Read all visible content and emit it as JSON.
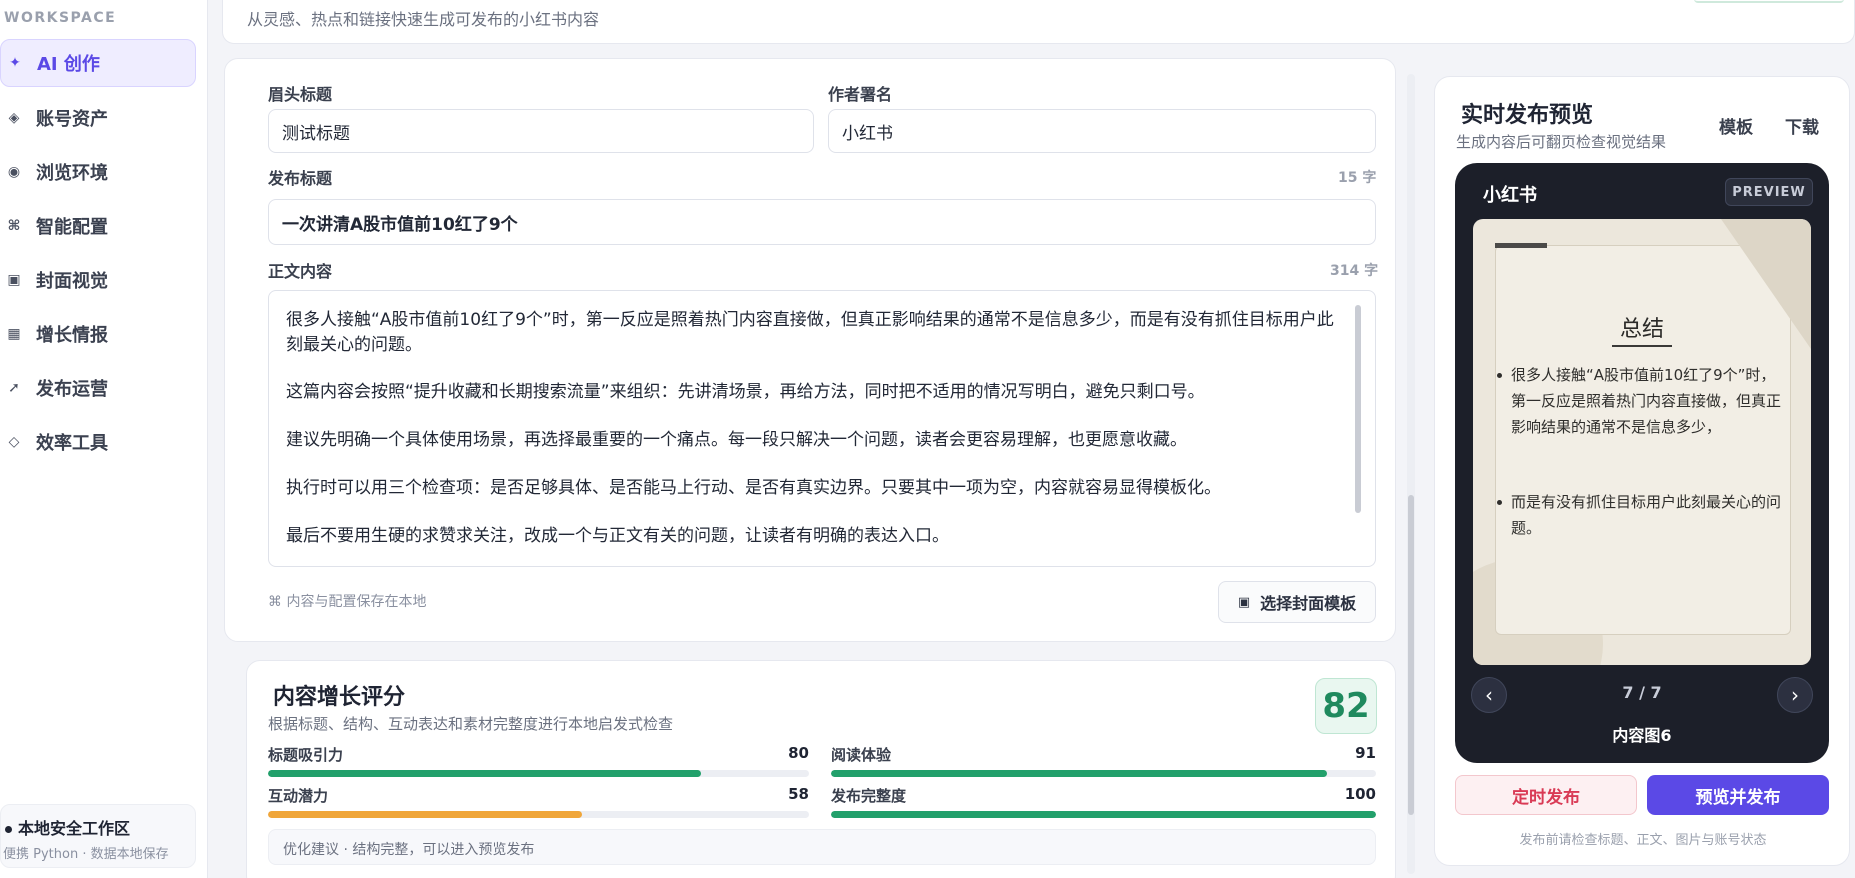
{
  "sidebar": {
    "workspace_label": "WORKSPACE",
    "items": [
      {
        "label": "AI 创作",
        "icon": "sparkle-icon",
        "glyph": "✦",
        "active": true
      },
      {
        "label": "账号资产",
        "icon": "asset-icon",
        "glyph": "◈",
        "active": false
      },
      {
        "label": "浏览环境",
        "icon": "browser-icon",
        "glyph": "◉",
        "active": false
      },
      {
        "label": "智能配置",
        "icon": "command-icon",
        "glyph": "⌘",
        "active": false
      },
      {
        "label": "封面视觉",
        "icon": "cover-icon",
        "glyph": "▣",
        "active": false
      },
      {
        "label": "增长情报",
        "icon": "chart-icon",
        "glyph": "▦",
        "active": false
      },
      {
        "label": "发布运营",
        "icon": "arrow-icon",
        "glyph": "➚",
        "active": false
      },
      {
        "label": "效率工具",
        "icon": "tool-icon",
        "glyph": "◇",
        "active": false
      }
    ],
    "local_title": "本地安全工作区",
    "local_sub": "便携 Python · 数据本地保存"
  },
  "header": {
    "subtitle": "从灵感、热点和链接快速生成可发布的小红书内容"
  },
  "editor": {
    "eyebrow_label": "眉头标题",
    "eyebrow_value": "测试标题",
    "author_label": "作者署名",
    "author_value": "小红书",
    "title_label": "发布标题",
    "title_count": "15 字",
    "title_value": "一次讲清A股市值前10红了9个",
    "body_label": "正文内容",
    "body_count": "314 字",
    "body_paragraphs": [
      "很多人接触“A股市值前10红了9个”时，第一反应是照着热门内容直接做，但真正影响结果的通常不是信息多少，而是有没有抓住目标用户此刻最关心的问题。",
      "这篇内容会按照“提升收藏和长期搜索流量”来组织：先讲清场景，再给方法，同时把不适用的情况写明白，避免只剩口号。",
      "建议先明确一个具体使用场景，再选择最重要的一个痛点。每一段只解决一个问题，读者会更容易理解，也更愿意收藏。",
      "执行时可以用三个检查项：是否足够具体、是否能马上行动、是否有真实边界。只要其中一项为空，内容就容易显得模板化。",
      "最后不要用生硬的求赞求关注，改成一个与正文有关的问题，让读者有明确的表达入口。"
    ],
    "save_note": "⌘  内容与配置保存在本地",
    "cover_button": "选择封面模板"
  },
  "score": {
    "title": "内容增长评分",
    "subtitle": "根据标题、结构、互动表达和素材完整度进行本地启发式检查",
    "total": "82",
    "metrics": [
      {
        "label": "标题吸引力",
        "value": "80",
        "pct": 80,
        "color": "#22a06b"
      },
      {
        "label": "阅读体验",
        "value": "91",
        "pct": 91,
        "color": "#22a06b"
      },
      {
        "label": "互动潜力",
        "value": "58",
        "pct": 58,
        "color": "#f0a63a"
      },
      {
        "label": "发布完整度",
        "value": "100",
        "pct": 100,
        "color": "#22a06b"
      }
    ],
    "advice": "优化建议 · 结构完整，可以进入预览发布"
  },
  "preview": {
    "title": "实时发布预览",
    "subtitle": "生成内容后可翻页检查视觉结果",
    "template_link": "模板",
    "download_link": "下载",
    "brand": "小红书",
    "badge": "PREVIEW",
    "card_title": "总结",
    "bullets": [
      "很多人接触“A股市值前10红了9个”时，第一反应是照着热门内容直接做，但真正影响结果的通常不是信息多少，",
      "而是有没有抓住目标用户此刻最关心的问题。"
    ],
    "prev": "‹",
    "next": "›",
    "page": "7 / 7",
    "caption": "内容图6",
    "schedule_button": "定时发布",
    "publish_button": "预览并发布",
    "footer": "发布前请检查标题、正文、图片与账号状态"
  }
}
